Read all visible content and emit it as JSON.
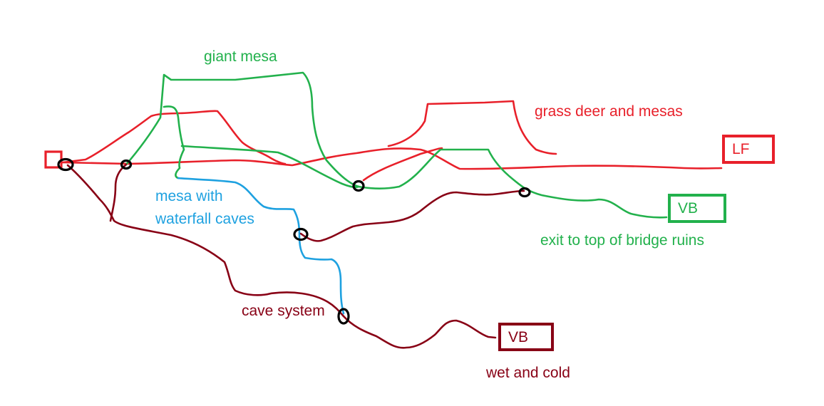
{
  "colors": {
    "red": "#e8202a",
    "green": "#22b14c",
    "blue": "#1ea1e0",
    "maroon": "#880015",
    "node": "#000000"
  },
  "labels": {
    "giant_mesa": "giant mesa",
    "grass_deer": "grass deer and mesas",
    "mesa_waterfall_line1": "mesa with",
    "mesa_waterfall_line2": "waterfall caves",
    "exit_bridge": "exit to top of bridge ruins",
    "cave_system": "cave system",
    "wet_cold": "wet and cold"
  },
  "boxes": {
    "lf": "LF",
    "vb_green": "VB",
    "vb_maroon": "VB"
  }
}
